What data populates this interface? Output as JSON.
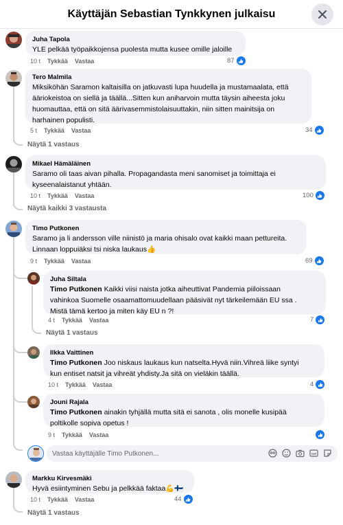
{
  "header": {
    "title": "Käyttäjän Sebastian Tynkkynen julkaisu"
  },
  "actions": {
    "like": "Tykkää",
    "reply": "Vastaa"
  },
  "comments": [
    {
      "author": "Juha Tapola",
      "text": "YLE pelkää työpaikkojensa puolesta mutta kusee omille jaloille",
      "time": "10 t",
      "likes": "87"
    },
    {
      "author": "Tero Malmila",
      "lines": [
        "Miksiköhän Saramon kaltaisilla on jatkuvasti lupa huudella ja mustamaalata, että",
        "ääriokeistoa on siellä ja täällä...Sitten kun aniharvoin mutta täysin aiheesta joku",
        "huomauttaa, että on sitä äärivasemmistolaisuuttakin, niin sitten mainitsija on",
        "harhainen populisti."
      ],
      "time": "5 t",
      "likes": "34",
      "replies_label": "Näytä 1 vastaus"
    },
    {
      "author": "Mikael Hämäläinen",
      "lines": [
        "Saramo oli taas aivan pihalla. Propagandasta meni sanomiset ja toimittaja ei",
        "kyseenalaistanut yhtään."
      ],
      "time": "10 t",
      "likes": "100",
      "replies_label": "Näytä kaikki 3 vastausta"
    },
    {
      "author": "Timo Putkonen",
      "lines": [
        "Saramo ja li andersson ville niinistö ja maria ohisalo ovat kaikki maan pettureita.",
        "Linnaan loppuiäksi tsi niska laukaus👍"
      ],
      "time": "9 t",
      "likes": "69"
    },
    {
      "author": "Markku Kirvesmäki",
      "text": "Hyvä esiintyminen Sebu ja pelkkää faktaa💪🇫🇮",
      "time": "10 t",
      "likes": "44",
      "replies_label": "Näytä 1 vastaus"
    }
  ],
  "replies": [
    {
      "author": "Juha Siltala",
      "mention": "Timo Putkonen",
      "lines": [
        " Kaikki viisi naista jotka aiheuttivat Pandemia piiloissaan",
        "vahinkoa Suomelle osaamattomuudellaan pääsivät nyt tärkeilemään EU ssa .",
        "Mistä tämä kertoo ja miten käy EU n ?!"
      ],
      "time": "4 t",
      "likes": "7",
      "replies_label": "Näytä 1 vastaus"
    },
    {
      "author": "Ilkka Vaittinen",
      "mention": "Timo Putkonen",
      "lines": [
        " Joo niskaus laukaus kun natselta.Hyvä niin.Vihreä liike syntyi",
        "kun entiset natsit ja vihreät yhdisty.Ja sitä on vieläkin täällä."
      ],
      "time": "10 t",
      "likes": "4"
    },
    {
      "author": "Jouni Rajala",
      "mention": "Timo Putkonen",
      "lines": [
        " ainakin tyhjällä mutta sitä ei sanota , olis monelle kusipää",
        "poltikolle sopiva opetus !"
      ],
      "time": "9 t",
      "likes": ""
    }
  ],
  "reply_input": {
    "placeholder": "Vastaa käyttäjälle Timo Putkonen..."
  },
  "colors": {
    "accent": "#1877f2",
    "bubble": "#f0f2f5",
    "meta": "#65676b"
  }
}
